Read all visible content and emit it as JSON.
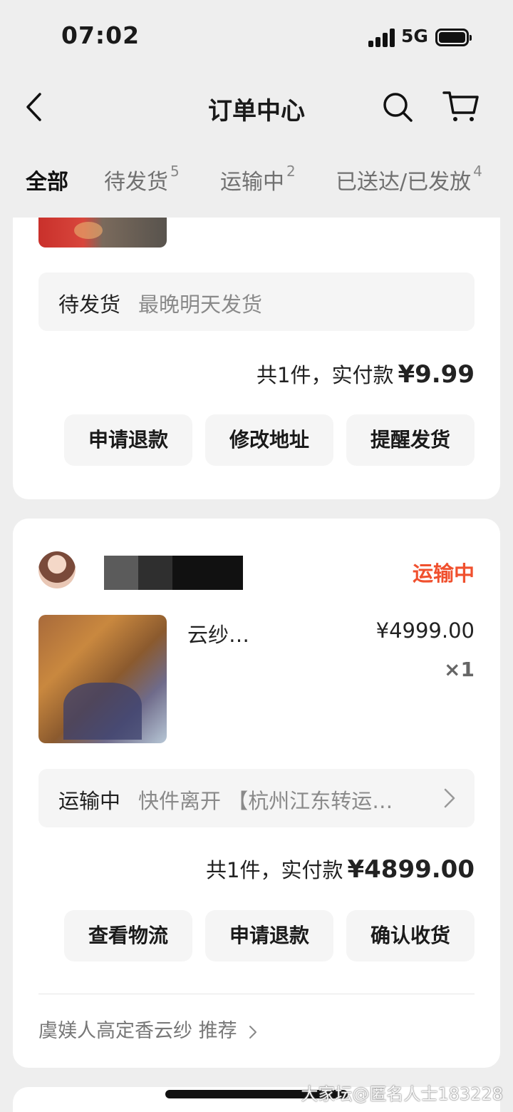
{
  "status_bar": {
    "time": "07:02",
    "network": "5G"
  },
  "header": {
    "title": "订单中心"
  },
  "tabs": [
    {
      "label": "全部",
      "count": ""
    },
    {
      "label": "待发货",
      "count": "5"
    },
    {
      "label": "运输中",
      "count": "2"
    },
    {
      "label": "已送达/已发放",
      "count": "4"
    }
  ],
  "order1": {
    "status_label": "待发货",
    "status_detail": "最晚明天发货",
    "total_text": "共1件，实付款",
    "total_amount": "¥9.99",
    "buttons": [
      "申请退款",
      "修改地址",
      "提醒发货"
    ]
  },
  "order2": {
    "order_status": "运输中",
    "product_title": "云纱…",
    "product_price": "¥4999.00",
    "product_qty": "×1",
    "status_label": "运输中",
    "status_detail": "快件离开 【杭州江东转运…",
    "total_text": "共1件，实付款",
    "total_amount": "¥4899.00",
    "buttons": [
      "查看物流",
      "申请退款",
      "确认收货"
    ],
    "recommend": "虞媄人高定香云纱 推荐"
  },
  "watermark": "大家坛@匿名人士183228"
}
